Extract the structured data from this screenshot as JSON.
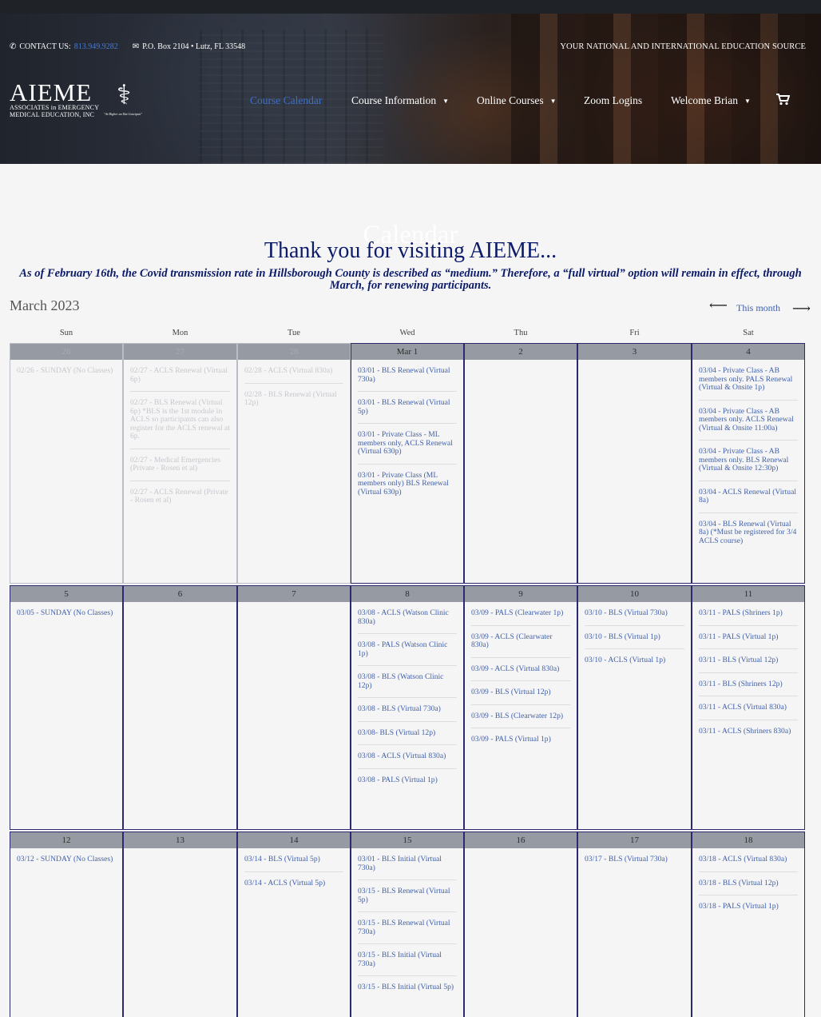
{
  "header": {
    "contact_label": "CONTACT US:",
    "phone": "813.949.9282",
    "address": "P.O. Box 2104 • Lutz, FL 33548",
    "tagline": "YOUR NATIONAL AND INTERNATIONAL EDUCATION SOURCE",
    "logo": {
      "name": "AIEME",
      "line1": "ASSOCIATES in EMERGENCY",
      "line2": "MEDICAL EDUCATION, INC",
      "motto": "\"At Higher an Dat Concipuit\""
    },
    "nav": [
      {
        "label": "Course Calendar",
        "active": true
      },
      {
        "label": "Course Information",
        "dropdown": true
      },
      {
        "label": "Online Courses",
        "dropdown": true
      },
      {
        "label": "Zoom Logins"
      },
      {
        "label": "Welcome Brian",
        "dropdown": true
      }
    ],
    "cart_icon": "cart-icon"
  },
  "page": {
    "ghost_title": "Calendar",
    "thanks": "Thank you for visiting AIEME...",
    "covid_notice": "As of February 16th, the Covid transmission rate in Hillsborough County is described as “medium.” Therefore, a “full virtual” option will remain in effect, through March, for renewing participants."
  },
  "calendar": {
    "month_title": "March 2023",
    "this_month_label": "This month",
    "prev_arrow": "⟵",
    "next_arrow": "⟶",
    "days_of_week": [
      "Sun",
      "Mon",
      "Tue",
      "Wed",
      "Thu",
      "Fri",
      "Sat"
    ],
    "weeks": [
      [
        {
          "label": "26",
          "other": true,
          "events": [
            "02/26 - SUNDAY (No Classes)"
          ]
        },
        {
          "label": "27",
          "other": true,
          "events": [
            "02/27 - ACLS Renewal (Virtual 6p)",
            "02/27 - BLS Renewal (Virtual 6p) *BLS is the 1st module in ACLS so participants can also register for the ACLS renewal at 6p.",
            "02/27 - Medical Emergencies (Private - Rosen et al)",
            "02/27 - ACLS Renewal (Private - Rosen et al)"
          ]
        },
        {
          "label": "28",
          "other": true,
          "events": [
            "02/28 - ACLS (Virtual 830a)",
            "02/28 - BLS Renewal (Virtual 12p)"
          ]
        },
        {
          "label": "Mar 1",
          "events": [
            "03/01 - BLS Renewal (Virtual 730a)",
            "03/01 - BLS Renewal (Virtual 5p)",
            "03/01 - Private Class - ML members only, ACLS Renewal (Virtual 630p)",
            "03/01 - Private Class (ML members only) BLS Renewal (Virtual 630p)"
          ]
        },
        {
          "label": "2",
          "events": []
        },
        {
          "label": "3",
          "events": []
        },
        {
          "label": "4",
          "events": [
            "03/04 - Private Class - AB members only. PALS Renewal (Virtual & Onsite 1p)",
            "03/04 - Private Class - AB members only. ACLS Renewal (Virtual & Onsite 11:00a)",
            "03/04 - Private Class - AB members only. BLS Renewal (Virtual & Onsite 12:30p)",
            "03/04 - ACLS Renewal (Virtual 8a)",
            "03/04 - BLS Renewal (Virtual 8a) (*Must be registered for 3/4 ACLS course)"
          ]
        }
      ],
      [
        {
          "label": "5",
          "events": [
            "03/05 - SUNDAY (No Classes)"
          ]
        },
        {
          "label": "6",
          "events": []
        },
        {
          "label": "7",
          "events": []
        },
        {
          "label": "8",
          "events": [
            "03/08 - ACLS (Watson Clinic 830a)",
            "03/08 - PALS (Watson Clinic 1p)",
            "03/08 - BLS (Watson Clinic 12p)",
            "03/08 - BLS (Virtual 730a)",
            "03/08- BLS (Virtual 12p)",
            "03/08 - ACLS (Virtual 830a)",
            "03/08 - PALS (Virtual 1p)"
          ]
        },
        {
          "label": "9",
          "events": [
            "03/09 - PALS (Clearwater 1p)",
            "03/09 - ACLS (Clearwater 830a)",
            "03/09 - ACLS (Virtual 830a)",
            "03/09 - BLS (Virtual 12p)",
            "03/09 - BLS (Clearwater 12p)",
            "03/09 - PALS (Virtual 1p)"
          ]
        },
        {
          "label": "10",
          "events": [
            "03/10 - BLS (Virtual 730a)",
            "03/10 - BLS (Virtual 1p)",
            "03/10 - ACLS (Virtual 1p)"
          ]
        },
        {
          "label": "11",
          "events": [
            "03/11 - PALS (Shriners 1p)",
            "03/11 - PALS (Virtual 1p)",
            "03/11 - BLS (Virtual 12p)",
            "03/11 - BLS (Shriners 12p)",
            "03/11 - ACLS (Virtual 830a)",
            "03/11 - ACLS (Shriners 830a)"
          ]
        }
      ],
      [
        {
          "label": "12",
          "events": [
            "03/12 - SUNDAY (No Classes)"
          ]
        },
        {
          "label": "13",
          "events": []
        },
        {
          "label": "14",
          "events": [
            "03/14 - BLS (Virtual 5p)",
            "03/14 - ACLS (Virtual 5p)"
          ]
        },
        {
          "label": "15",
          "events": [
            "03/01 - BLS Initial (Virtual 730a)",
            "03/15 - BLS Renewal (Virtual 5p)",
            "03/15 - BLS Renewal (Virtual 730a)",
            "03/15 - BLS Initial (Virtual 730a)",
            "03/15 - BLS Initial (Virtual 5p)"
          ]
        },
        {
          "label": "16",
          "events": []
        },
        {
          "label": "17",
          "events": [
            "03/17 - BLS (Virtual 730a)"
          ]
        },
        {
          "label": "18",
          "events": [
            "03/18 - ACLS (Virtual 830a)",
            "03/18 - BLS (Virtual 12p)",
            "03/18 - PALS (Virtual 1p)"
          ]
        }
      ]
    ]
  }
}
